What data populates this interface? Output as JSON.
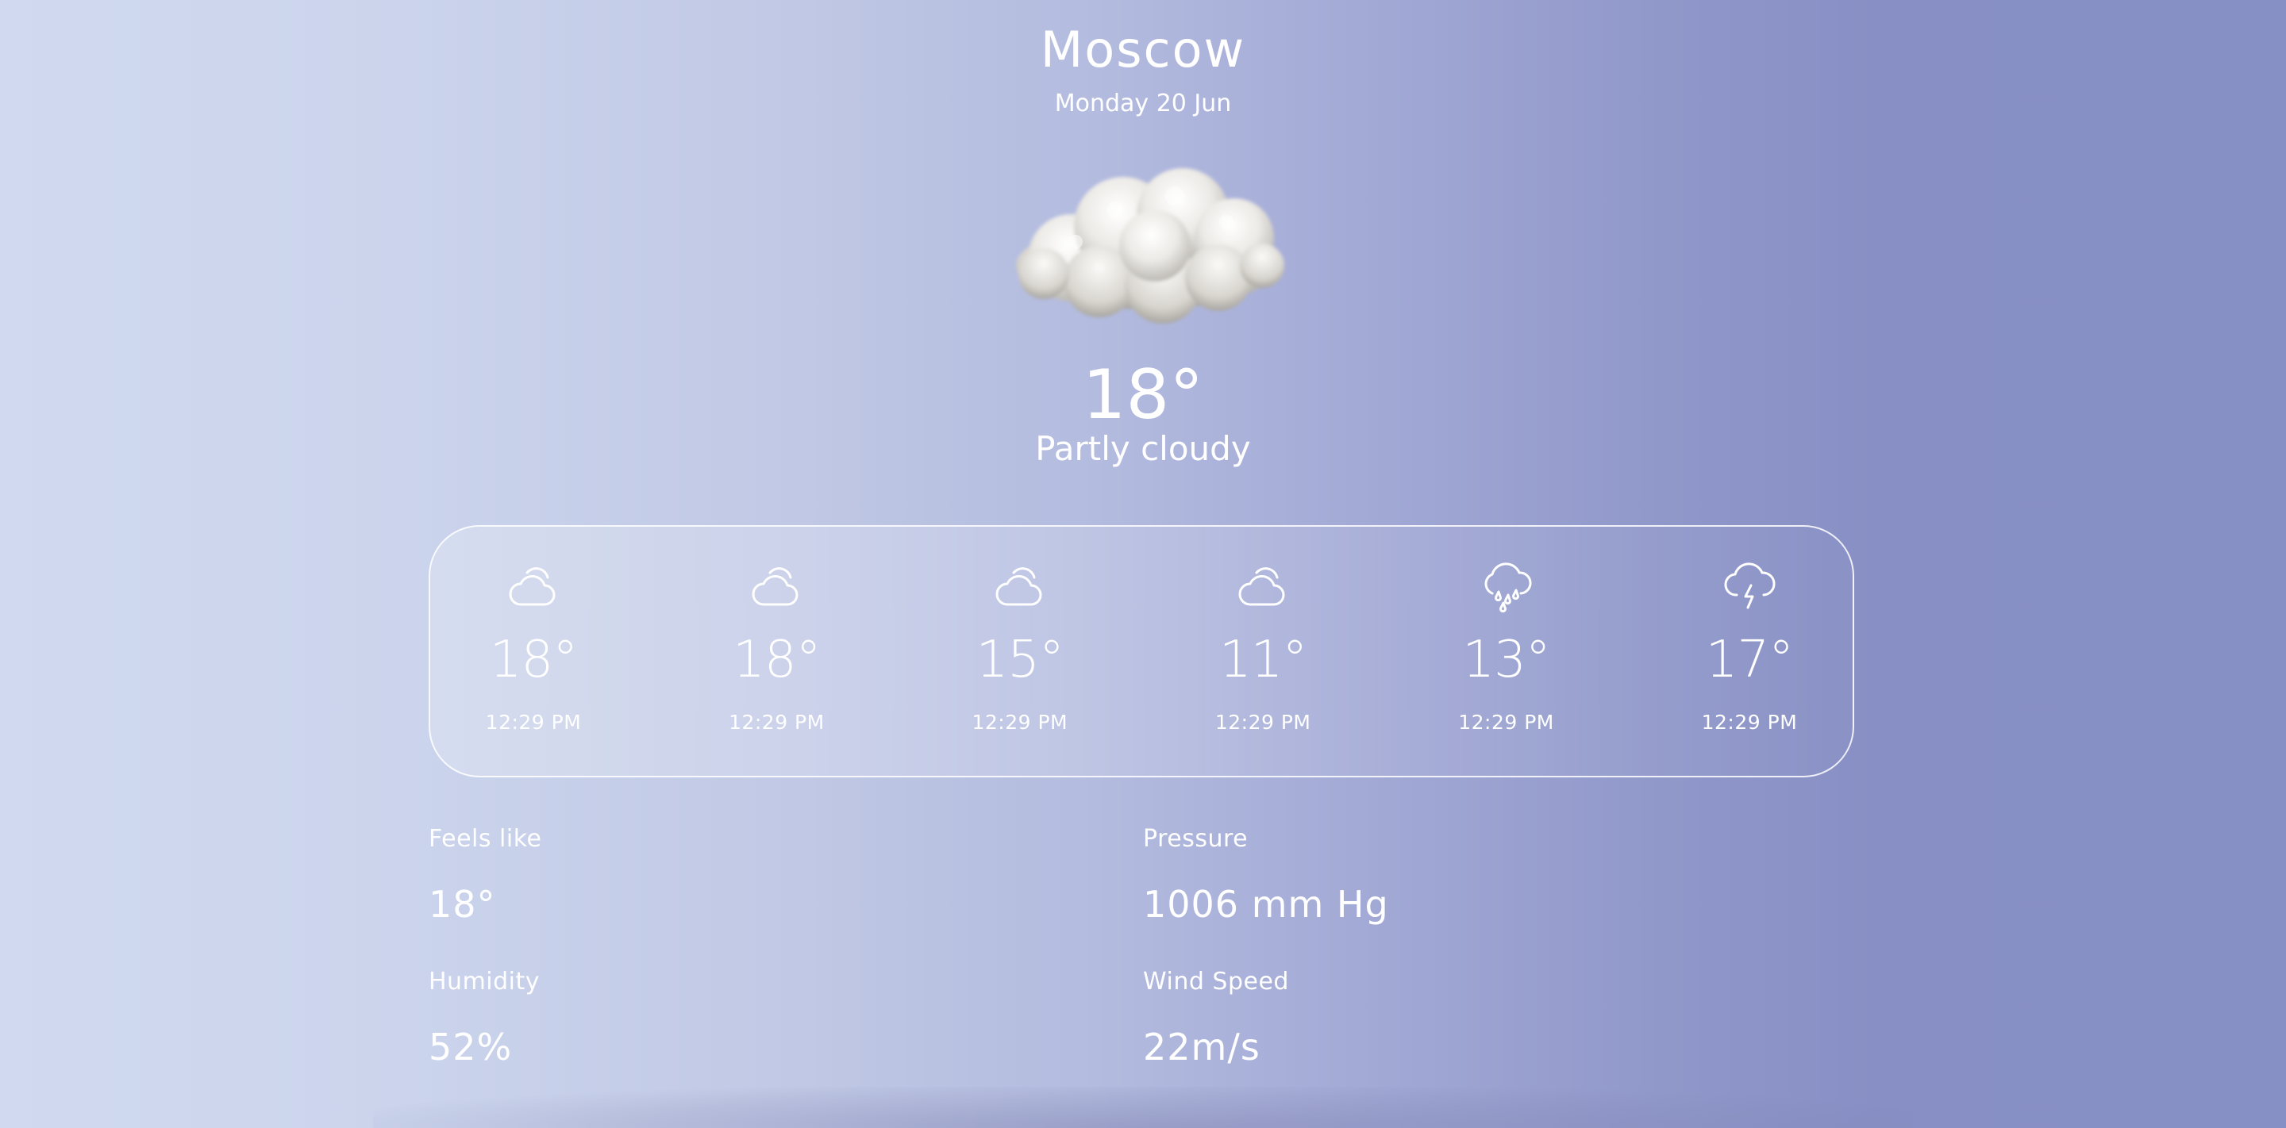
{
  "header": {
    "city": "Moscow",
    "date": "Monday 20 Jun"
  },
  "current": {
    "icon": "cloud-icon",
    "temperature": "18°",
    "condition": "Partly cloudy"
  },
  "forecast": [
    {
      "icon": "partly-cloudy-icon",
      "temp": "18°",
      "time": "12:29 PM"
    },
    {
      "icon": "partly-cloudy-icon",
      "temp": "18°",
      "time": "12:29 PM"
    },
    {
      "icon": "partly-cloudy-icon",
      "temp": "15°",
      "time": "12:29 PM"
    },
    {
      "icon": "partly-cloudy-icon",
      "temp": "11°",
      "time": "12:29 PM"
    },
    {
      "icon": "rain-cloud-icon",
      "temp": "13°",
      "time": "12:29 PM"
    },
    {
      "icon": "thunderstorm-icon",
      "temp": "17°",
      "time": "12:29 PM"
    }
  ],
  "details": {
    "feels_like": {
      "label": "Feels like",
      "value": "18°"
    },
    "pressure": {
      "label": "Pressure",
      "value": "1006 mm Hg"
    },
    "humidity": {
      "label": "Humidity",
      "value": "52%"
    },
    "wind_speed": {
      "label": "Wind Speed",
      "value": "22m/s"
    }
  },
  "colors": {
    "background_left": "#d0d9ef",
    "background_right": "#878fc4",
    "text": "#ffffff"
  }
}
